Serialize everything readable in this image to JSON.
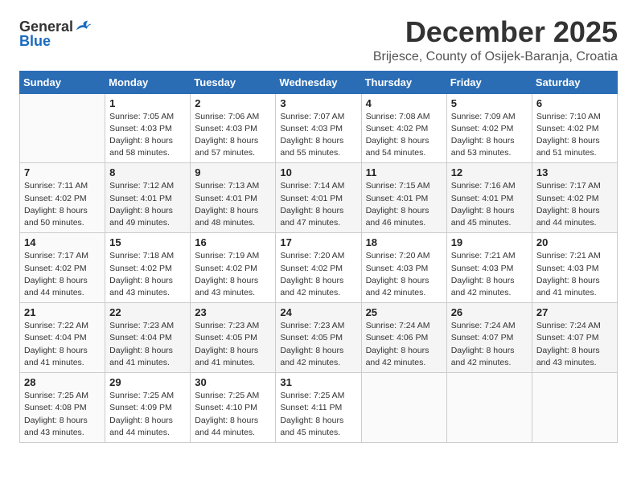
{
  "logo": {
    "general": "General",
    "blue": "Blue"
  },
  "title": "December 2025",
  "subtitle": "Brijesce, County of Osijek-Baranja, Croatia",
  "days_of_week": [
    "Sunday",
    "Monday",
    "Tuesday",
    "Wednesday",
    "Thursday",
    "Friday",
    "Saturday"
  ],
  "weeks": [
    [
      {
        "day": "",
        "info": ""
      },
      {
        "day": "1",
        "info": "Sunrise: 7:05 AM\nSunset: 4:03 PM\nDaylight: 8 hours\nand 58 minutes."
      },
      {
        "day": "2",
        "info": "Sunrise: 7:06 AM\nSunset: 4:03 PM\nDaylight: 8 hours\nand 57 minutes."
      },
      {
        "day": "3",
        "info": "Sunrise: 7:07 AM\nSunset: 4:03 PM\nDaylight: 8 hours\nand 55 minutes."
      },
      {
        "day": "4",
        "info": "Sunrise: 7:08 AM\nSunset: 4:02 PM\nDaylight: 8 hours\nand 54 minutes."
      },
      {
        "day": "5",
        "info": "Sunrise: 7:09 AM\nSunset: 4:02 PM\nDaylight: 8 hours\nand 53 minutes."
      },
      {
        "day": "6",
        "info": "Sunrise: 7:10 AM\nSunset: 4:02 PM\nDaylight: 8 hours\nand 51 minutes."
      }
    ],
    [
      {
        "day": "7",
        "info": "Sunrise: 7:11 AM\nSunset: 4:02 PM\nDaylight: 8 hours\nand 50 minutes."
      },
      {
        "day": "8",
        "info": "Sunrise: 7:12 AM\nSunset: 4:01 PM\nDaylight: 8 hours\nand 49 minutes."
      },
      {
        "day": "9",
        "info": "Sunrise: 7:13 AM\nSunset: 4:01 PM\nDaylight: 8 hours\nand 48 minutes."
      },
      {
        "day": "10",
        "info": "Sunrise: 7:14 AM\nSunset: 4:01 PM\nDaylight: 8 hours\nand 47 minutes."
      },
      {
        "day": "11",
        "info": "Sunrise: 7:15 AM\nSunset: 4:01 PM\nDaylight: 8 hours\nand 46 minutes."
      },
      {
        "day": "12",
        "info": "Sunrise: 7:16 AM\nSunset: 4:01 PM\nDaylight: 8 hours\nand 45 minutes."
      },
      {
        "day": "13",
        "info": "Sunrise: 7:17 AM\nSunset: 4:02 PM\nDaylight: 8 hours\nand 44 minutes."
      }
    ],
    [
      {
        "day": "14",
        "info": "Sunrise: 7:17 AM\nSunset: 4:02 PM\nDaylight: 8 hours\nand 44 minutes."
      },
      {
        "day": "15",
        "info": "Sunrise: 7:18 AM\nSunset: 4:02 PM\nDaylight: 8 hours\nand 43 minutes."
      },
      {
        "day": "16",
        "info": "Sunrise: 7:19 AM\nSunset: 4:02 PM\nDaylight: 8 hours\nand 43 minutes."
      },
      {
        "day": "17",
        "info": "Sunrise: 7:20 AM\nSunset: 4:02 PM\nDaylight: 8 hours\nand 42 minutes."
      },
      {
        "day": "18",
        "info": "Sunrise: 7:20 AM\nSunset: 4:03 PM\nDaylight: 8 hours\nand 42 minutes."
      },
      {
        "day": "19",
        "info": "Sunrise: 7:21 AM\nSunset: 4:03 PM\nDaylight: 8 hours\nand 42 minutes."
      },
      {
        "day": "20",
        "info": "Sunrise: 7:21 AM\nSunset: 4:03 PM\nDaylight: 8 hours\nand 41 minutes."
      }
    ],
    [
      {
        "day": "21",
        "info": "Sunrise: 7:22 AM\nSunset: 4:04 PM\nDaylight: 8 hours\nand 41 minutes."
      },
      {
        "day": "22",
        "info": "Sunrise: 7:23 AM\nSunset: 4:04 PM\nDaylight: 8 hours\nand 41 minutes."
      },
      {
        "day": "23",
        "info": "Sunrise: 7:23 AM\nSunset: 4:05 PM\nDaylight: 8 hours\nand 41 minutes."
      },
      {
        "day": "24",
        "info": "Sunrise: 7:23 AM\nSunset: 4:05 PM\nDaylight: 8 hours\nand 42 minutes."
      },
      {
        "day": "25",
        "info": "Sunrise: 7:24 AM\nSunset: 4:06 PM\nDaylight: 8 hours\nand 42 minutes."
      },
      {
        "day": "26",
        "info": "Sunrise: 7:24 AM\nSunset: 4:07 PM\nDaylight: 8 hours\nand 42 minutes."
      },
      {
        "day": "27",
        "info": "Sunrise: 7:24 AM\nSunset: 4:07 PM\nDaylight: 8 hours\nand 43 minutes."
      }
    ],
    [
      {
        "day": "28",
        "info": "Sunrise: 7:25 AM\nSunset: 4:08 PM\nDaylight: 8 hours\nand 43 minutes."
      },
      {
        "day": "29",
        "info": "Sunrise: 7:25 AM\nSunset: 4:09 PM\nDaylight: 8 hours\nand 44 minutes."
      },
      {
        "day": "30",
        "info": "Sunrise: 7:25 AM\nSunset: 4:10 PM\nDaylight: 8 hours\nand 44 minutes."
      },
      {
        "day": "31",
        "info": "Sunrise: 7:25 AM\nSunset: 4:11 PM\nDaylight: 8 hours\nand 45 minutes."
      },
      {
        "day": "",
        "info": ""
      },
      {
        "day": "",
        "info": ""
      },
      {
        "day": "",
        "info": ""
      }
    ]
  ]
}
